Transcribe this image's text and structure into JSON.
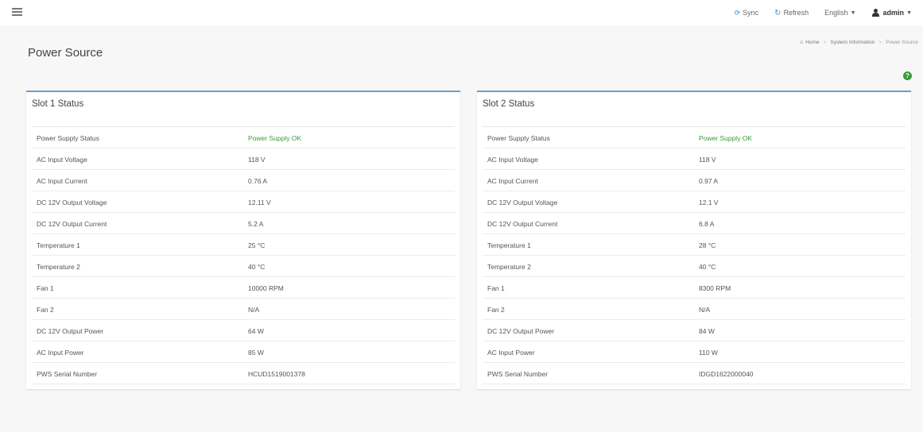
{
  "topbar": {
    "sync_label": "Sync",
    "refresh_label": "Refresh",
    "language_label": "English",
    "user_label": "admin"
  },
  "page": {
    "title": "Power Source"
  },
  "breadcrumb": {
    "home": "Home",
    "parent": "System Information",
    "current": "Power Source"
  },
  "icons": {
    "help": "help-icon",
    "sync": "sync-icon",
    "refresh": "refresh-icon",
    "user": "user-icon",
    "menu": "hamburger-menu-icon",
    "home": "home-icon"
  },
  "colors": {
    "accent": "#3a8fd8",
    "ok_status": "#3a9a3a",
    "panel_border": "#6aa0c8"
  },
  "slots": [
    {
      "title": "Slot 1 Status",
      "rows": [
        {
          "label": "Power Supply Status",
          "value": "Power Supply OK"
        },
        {
          "label": "AC Input Voltage",
          "value": "118 V"
        },
        {
          "label": "AC Input Current",
          "value": "0.76 A"
        },
        {
          "label": "DC 12V Output Voltage",
          "value": "12.11 V"
        },
        {
          "label": "DC 12V Output Current",
          "value": "5.2 A"
        },
        {
          "label": "Temperature 1",
          "value": "25 °C"
        },
        {
          "label": "Temperature 2",
          "value": "40 °C"
        },
        {
          "label": "Fan 1",
          "value": "10000 RPM"
        },
        {
          "label": "Fan 2",
          "value": "N/A"
        },
        {
          "label": "DC 12V Output Power",
          "value": "64 W"
        },
        {
          "label": "AC Input Power",
          "value": "85 W"
        },
        {
          "label": "PWS Serial Number",
          "value": "HCUD1519001378"
        }
      ]
    },
    {
      "title": "Slot 2 Status",
      "rows": [
        {
          "label": "Power Supply Status",
          "value": "Power Supply OK"
        },
        {
          "label": "AC Input Voltage",
          "value": "118 V"
        },
        {
          "label": "AC Input Current",
          "value": "0.97 A"
        },
        {
          "label": "DC 12V Output Voltage",
          "value": "12.1 V"
        },
        {
          "label": "DC 12V Output Current",
          "value": "6.8 A"
        },
        {
          "label": "Temperature 1",
          "value": "28 °C"
        },
        {
          "label": "Temperature 2",
          "value": "40 °C"
        },
        {
          "label": "Fan 1",
          "value": "8300 RPM"
        },
        {
          "label": "Fan 2",
          "value": "N/A"
        },
        {
          "label": "DC 12V Output Power",
          "value": "84 W"
        },
        {
          "label": "AC Input Power",
          "value": "110 W"
        },
        {
          "label": "PWS Serial Number",
          "value": "IDGD1622000040"
        }
      ]
    }
  ]
}
